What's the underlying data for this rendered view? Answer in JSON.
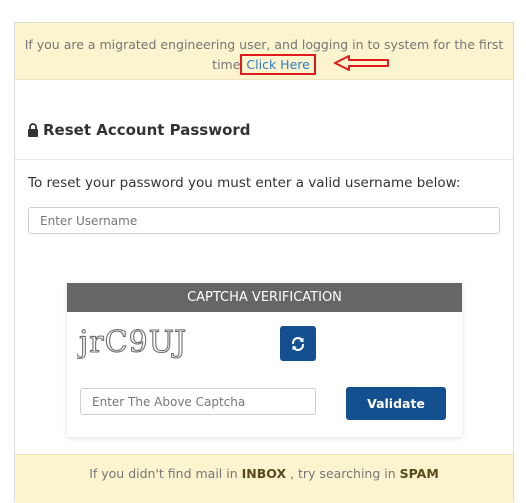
{
  "notice_top": {
    "text_line1": "If you are a migrated engineering user, and logging in to system for the first",
    "text_line2": "time",
    "link_label": "Click Here"
  },
  "reset": {
    "title": "Reset Account Password",
    "instruction": "To reset your password you must enter a valid username below:",
    "username_placeholder": "Enter Username"
  },
  "captcha": {
    "header": "CAPTCHA VERIFICATION",
    "code": "jrC9UJ",
    "input_placeholder": "Enter The Above Captcha",
    "validate_label": "Validate"
  },
  "notice_bottom": {
    "prefix": "If you didn't find mail in",
    "inbox": "INBOX",
    "middle": ", try searching in",
    "spam": "SPAM"
  },
  "colors": {
    "notice_bg": "#fcf3cf",
    "primary_button": "#144f8f",
    "captcha_header_bg": "#666666",
    "highlight_red": "#e11b1b",
    "link_blue": "#2a7ec8"
  },
  "icons": {
    "lock": "lock-icon",
    "refresh": "refresh-icon",
    "arrow": "left-arrow-icon"
  }
}
